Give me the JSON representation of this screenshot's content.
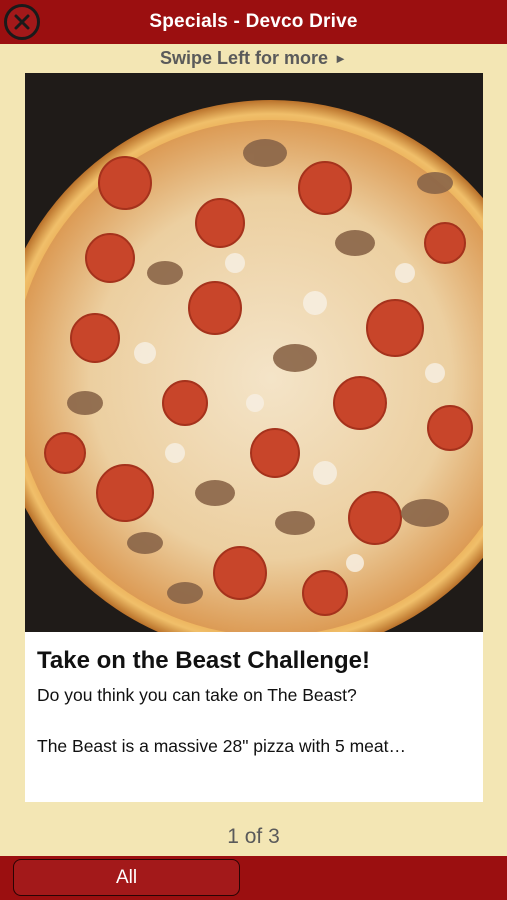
{
  "header": {
    "title": "Specials - Devco Drive",
    "close_icon": "close-circle-x-icon"
  },
  "swipe_hint": {
    "text": "Swipe Left for more",
    "arrow": "►"
  },
  "card": {
    "image": "pizza-photo",
    "title": "Take on the Beast Challenge!",
    "line1": "Do you think you can take on The Beast?",
    "line2": "The Beast is a massive 28\" pizza with 5 meat…"
  },
  "pager": {
    "text": "1 of 3"
  },
  "bottom": {
    "all_label": "All"
  },
  "colors": {
    "bar": "#9b0f10",
    "background": "#f3e6b4"
  }
}
